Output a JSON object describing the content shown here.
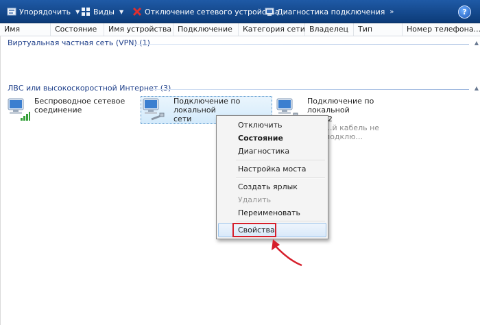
{
  "toolbar": {
    "organize": "Упорядочить",
    "views": "Виды",
    "disable": "Отключение сетевого устройства",
    "diagnose": "Диагностика подключения",
    "help": "?"
  },
  "columns": [
    "Имя",
    "Состояние",
    "Имя устройства",
    "Подключение",
    "Категория сети",
    "Владелец",
    "Тип",
    "Номер телефона..."
  ],
  "groups": {
    "vpn": "Виртуальная частная сеть (VPN) (1)",
    "lan": "ЛВС или высокоскоростной Интернет (3)"
  },
  "connections": [
    {
      "line1": "Беспроводное сетевое",
      "line2": "соединение",
      "status": ""
    },
    {
      "line1": "Подключение по локальной",
      "line2": "сети",
      "status": ""
    },
    {
      "line1": "Подключение по локальной",
      "line2": "сети 2",
      "status": "...й кабель не подклю..."
    }
  ],
  "context_menu": {
    "disable": "Отключить",
    "status": "Состояние",
    "diagnose": "Диагностика",
    "bridge": "Настройка моста",
    "shortcut": "Создать ярлык",
    "delete": "Удалить",
    "rename": "Переименовать",
    "properties": "Свойства"
  },
  "colors": {
    "toolbar": "#1f5aa6",
    "group_text": "#1e3f8a",
    "highlight_box": "#d61f2b"
  }
}
